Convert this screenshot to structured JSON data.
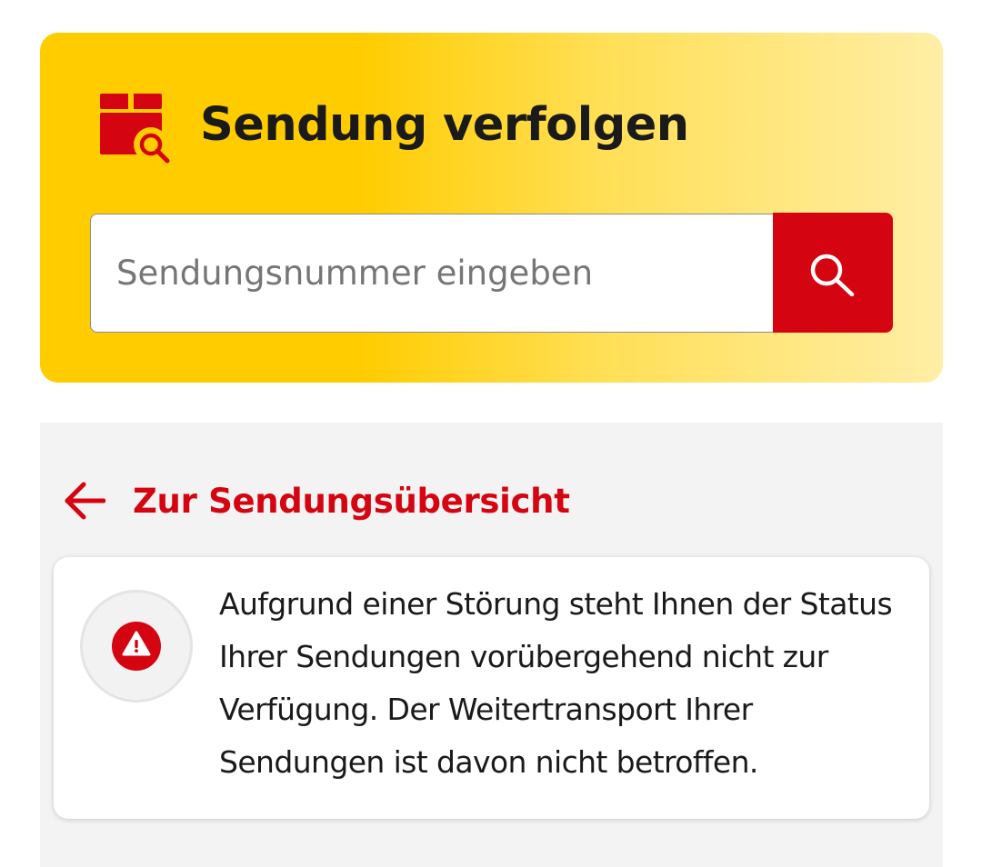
{
  "tracking": {
    "title": "Sendung verfolgen",
    "icon": "package-search-icon",
    "search": {
      "placeholder": "Sendungsnummer eingeben",
      "value": "",
      "button_icon": "search-icon"
    }
  },
  "status_panel": {
    "back_link": {
      "icon": "arrow-left-icon",
      "label": "Zur Sendungsübersicht"
    },
    "notice": {
      "icon": "warning-icon",
      "text": "Aufgrund einer Störung steht Ihnen der Status Ihrer Sendungen vorübergehend nicht zur Verfügung. Der Weitertransport Ihrer Sendungen ist davon nicht betroffen."
    }
  },
  "colors": {
    "brand_yellow": "#ffcc00",
    "brand_red": "#d40511",
    "panel_gray": "#f3f3f3",
    "text_dark": "#1a1a1a"
  }
}
